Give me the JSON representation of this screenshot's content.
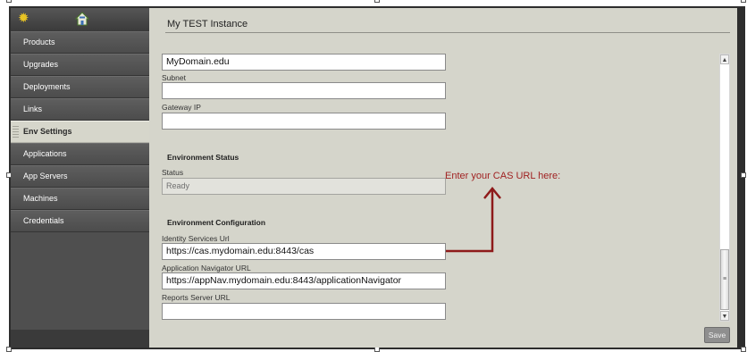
{
  "sidebar": {
    "items": [
      {
        "label": "Products"
      },
      {
        "label": "Upgrades"
      },
      {
        "label": "Deployments"
      },
      {
        "label": "Links"
      },
      {
        "label": "Env Settings"
      },
      {
        "label": "Applications"
      },
      {
        "label": "App Servers"
      },
      {
        "label": "Machines"
      },
      {
        "label": "Credentials"
      }
    ],
    "active": "Env Settings",
    "icons": [
      "gear-icon",
      "home-icon"
    ]
  },
  "main": {
    "title": "My TEST Instance",
    "domain_value": "MyDomain.edu",
    "subnet": {
      "label": "Subnet",
      "value": ""
    },
    "gateway": {
      "label": "Gateway IP",
      "value": ""
    },
    "env_status": {
      "heading": "Environment Status",
      "status_label": "Status",
      "status_value": "Ready"
    },
    "env_config": {
      "heading": "Environment Configuration",
      "identity": {
        "label": "Identity Services Url",
        "value": "https://cas.mydomain.edu:8443/cas"
      },
      "appnav": {
        "label": "Application Navigator URL",
        "value": "https://appNav.mydomain.edu:8443/applicationNavigator"
      },
      "reports": {
        "label": "Reports Server URL",
        "value": ""
      }
    },
    "save_label": "Save"
  },
  "annotation": {
    "text": "Enter your CAS URL here:",
    "color": "#a02222"
  },
  "colors": {
    "sidebar": "#4f4f4f",
    "active_item": "#d6d6cb",
    "content": "#d5d5cb"
  }
}
